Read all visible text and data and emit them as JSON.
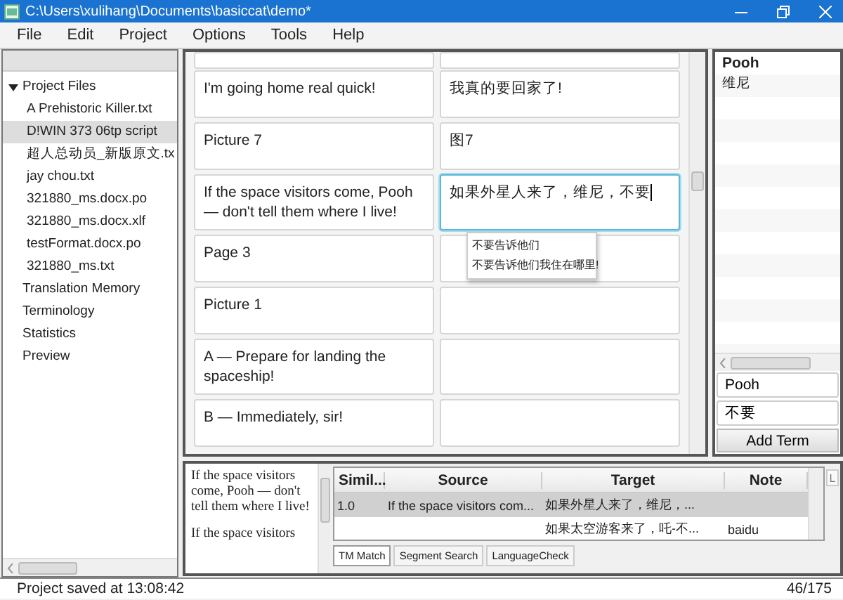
{
  "window": {
    "title": "C:\\Users\\xulihang\\Documents\\basiccat\\demo*"
  },
  "menu": [
    "File",
    "Edit",
    "Project",
    "Options",
    "Tools",
    "Help"
  ],
  "project_tree": [
    {
      "label": "Project Files",
      "expanded": true,
      "selected": false,
      "children": [
        {
          "label": "A Prehistoric Killer.txt",
          "selected": false
        },
        {
          "label": "D!WIN 373 06tp script",
          "selected": true
        },
        {
          "label": "超人总动员_新版原文.tx",
          "selected": false
        },
        {
          "label": "jay chou.txt",
          "selected": false
        },
        {
          "label": "321880_ms.docx.po",
          "selected": false
        },
        {
          "label": "321880_ms.docx.xlf",
          "selected": false
        },
        {
          "label": "testFormat.docx.po",
          "selected": false
        },
        {
          "label": "321880_ms.txt",
          "selected": false
        }
      ]
    },
    {
      "label": "Translation Memory",
      "selected": false
    },
    {
      "label": "Terminology",
      "selected": false
    },
    {
      "label": "Statistics",
      "selected": false
    },
    {
      "label": "Preview",
      "selected": false
    }
  ],
  "segments": [
    {
      "source": "I'm going home real quick!",
      "target": "我真的要回家了!",
      "selected": false
    },
    {
      "source": "Picture 7",
      "target": "图7",
      "selected": false
    },
    {
      "source": "If the space visitors come, Pooh — don't tell them where I live!",
      "target": "如果外星人来了，维尼，不要",
      "selected": true
    },
    {
      "source": "Page 3",
      "selected": false
    },
    {
      "source": "Picture 1",
      "selected": false
    },
    {
      "source": "A — Prepare for landing the spaceship!",
      "selected": false
    },
    {
      "source": "B — Immediately, sir!",
      "selected": false
    }
  ],
  "autocomplete": [
    "不要告诉他们",
    "不要告诉他们我住在哪里!"
  ],
  "glossary": {
    "entries": [
      {
        "term": "Pooh",
        "translation": "维尼"
      }
    ],
    "source_field": "Pooh",
    "target_field": "不要",
    "button": "Add Term"
  },
  "preview": [
    "If the space visitors come, Pooh — don't tell them where I live!",
    "If the space visitors"
  ],
  "matches": {
    "columns": [
      "Simil...",
      "Source",
      "Target",
      "Note"
    ],
    "rows": [
      {
        "similarity": "1.0",
        "source": "If the space visitors com...",
        "target": "如果外星人来了，维尼，...",
        "selected": true
      },
      {
        "target": "如果太空游客来了，吒-不...",
        "note": "baidu",
        "selected": false
      }
    ]
  },
  "tabs": [
    {
      "label": "TM Match",
      "selected": true
    },
    {
      "label": "Segment Search",
      "selected": false
    },
    {
      "label": "LanguageCheck",
      "selected": false
    }
  ],
  "side_button": "L",
  "status_bar": {
    "message": "Project saved at 13:08:42",
    "progress": "46/175"
  }
}
